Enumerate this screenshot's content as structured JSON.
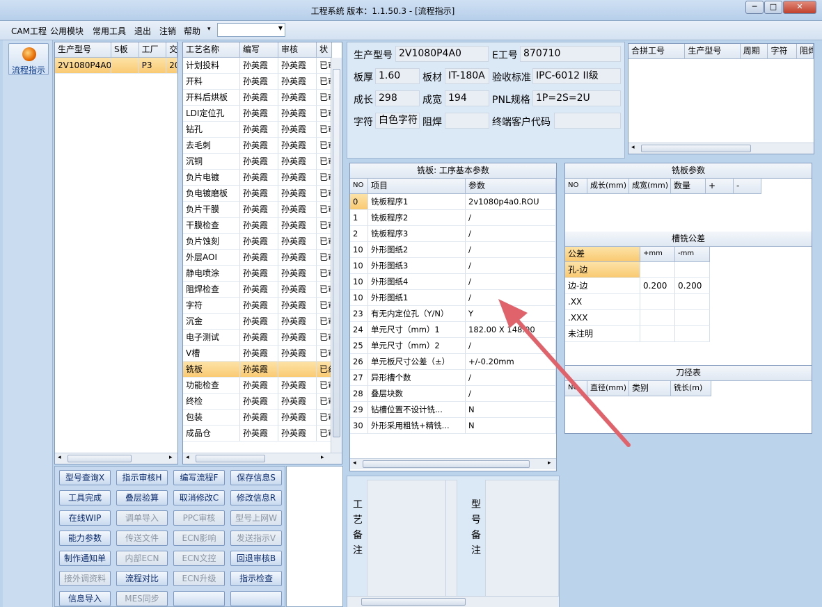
{
  "window": {
    "title": "工程系统   版本：1.1.50.3 - [流程指示]",
    "min": "─",
    "max": "□",
    "close": "✕"
  },
  "menu": {
    "items": [
      "CAM工程",
      "公用模块",
      "常用工具",
      "退出",
      "注销",
      "帮助"
    ],
    "combo_value": "",
    "mdi": [
      "_",
      "🗗",
      "×"
    ]
  },
  "sidebar": {
    "button_label": "流程指示",
    "icon": "flame-icon"
  },
  "model_grid": {
    "headers": [
      "生产型号",
      "S板",
      "工厂",
      "交"
    ],
    "rows": [
      [
        "2V1080P4A0",
        "",
        "P3",
        "20"
      ]
    ]
  },
  "process_grid": {
    "headers": [
      "工艺名称",
      "编写",
      "审核",
      "状"
    ],
    "rows": [
      [
        "计划投料",
        "孙英霞",
        "孙英霞",
        "已审"
      ],
      [
        "开料",
        "孙英霞",
        "孙英霞",
        "已审"
      ],
      [
        "开料后烘板",
        "孙英霞",
        "孙英霞",
        "已审"
      ],
      [
        "LDI定位孔",
        "孙英霞",
        "孙英霞",
        "已审"
      ],
      [
        "钻孔",
        "孙英霞",
        "孙英霞",
        "已审"
      ],
      [
        "去毛刺",
        "孙英霞",
        "孙英霞",
        "已审"
      ],
      [
        "沉铜",
        "孙英霞",
        "孙英霞",
        "已审"
      ],
      [
        "负片电镀",
        "孙英霞",
        "孙英霞",
        "已审"
      ],
      [
        "负电镀磨板",
        "孙英霞",
        "孙英霞",
        "已审"
      ],
      [
        "负片干膜",
        "孙英霞",
        "孙英霞",
        "已审"
      ],
      [
        "干膜检查",
        "孙英霞",
        "孙英霞",
        "已审"
      ],
      [
        "负片蚀刻",
        "孙英霞",
        "孙英霞",
        "已审"
      ],
      [
        "外层AOI",
        "孙英霞",
        "孙英霞",
        "已审"
      ],
      [
        "静电喷涂",
        "孙英霞",
        "孙英霞",
        "已审"
      ],
      [
        "阻焊检查",
        "孙英霞",
        "孙英霞",
        "已审"
      ],
      [
        "字符",
        "孙英霞",
        "孙英霞",
        "已审"
      ],
      [
        "沉金",
        "孙英霞",
        "孙英霞",
        "已审"
      ],
      [
        "电子测试",
        "孙英霞",
        "孙英霞",
        "已审"
      ],
      [
        "V槽",
        "孙英霞",
        "孙英霞",
        "已审"
      ],
      [
        "铣板",
        "孙英霞",
        "",
        "已纟"
      ],
      [
        "功能检查",
        "孙英霞",
        "孙英霞",
        "已审"
      ],
      [
        "终检",
        "孙英霞",
        "孙英霞",
        "已审"
      ],
      [
        "包装",
        "孙英霞",
        "孙英霞",
        "已审"
      ],
      [
        "成品仓",
        "孙英霞",
        "孙英霞",
        "已审"
      ]
    ],
    "selected_index": 19
  },
  "buttons": [
    {
      "label": "型号查询X",
      "enabled": true
    },
    {
      "label": "指示审核H",
      "enabled": true
    },
    {
      "label": "编写流程F",
      "enabled": true
    },
    {
      "label": "保存信息S",
      "enabled": true
    },
    {
      "label": "工具完成",
      "enabled": true
    },
    {
      "label": "叠层验算",
      "enabled": true
    },
    {
      "label": "取消修改C",
      "enabled": true
    },
    {
      "label": "修改信息R",
      "enabled": true
    },
    {
      "label": "在线WIP",
      "enabled": true
    },
    {
      "label": "调单导入",
      "enabled": false
    },
    {
      "label": "PPC审核",
      "enabled": false
    },
    {
      "label": "型号上网W",
      "enabled": false
    },
    {
      "label": "能力参数",
      "enabled": true
    },
    {
      "label": "传送文件",
      "enabled": false
    },
    {
      "label": "ECN影响",
      "enabled": false
    },
    {
      "label": "发送指示V",
      "enabled": false
    },
    {
      "label": "制作通知单",
      "enabled": true
    },
    {
      "label": "内部ECN",
      "enabled": false
    },
    {
      "label": "ECN文控",
      "enabled": false
    },
    {
      "label": "回退审核B",
      "enabled": true
    },
    {
      "label": "接外调资料",
      "enabled": false
    },
    {
      "label": "流程对比",
      "enabled": true
    },
    {
      "label": "ECN升级",
      "enabled": false
    },
    {
      "label": "指示检查",
      "enabled": true
    },
    {
      "label": "信息导入",
      "enabled": true
    },
    {
      "label": "MES同步",
      "enabled": false
    },
    {
      "label": "",
      "enabled": true
    },
    {
      "label": "",
      "enabled": true
    }
  ],
  "form": {
    "product_model_label": "生产型号",
    "product_model": "2V1080P4A0",
    "e_no_label": "E工号",
    "e_no": "870710",
    "thickness_label": "板厚",
    "thickness": "1.60",
    "material_label": "板材",
    "material": "IT-180A",
    "standard_label": "验收标准",
    "standard": "IPC-6012 II级",
    "length_label": "成长",
    "length": "298",
    "width_label": "成宽",
    "width": "194",
    "pnl_label": "PNL规格",
    "pnl": "1P=2S=2U",
    "char_label": "字符",
    "char": "白色字符",
    "mask_label": "阻焊",
    "mask": "",
    "customer_label": "终端客户代码",
    "customer": ""
  },
  "merge_grid": {
    "headers": [
      "合拼工号",
      "生产型号",
      "周期",
      "字符",
      "阻焊"
    ]
  },
  "mill_basic": {
    "title": "铣板: 工序基本参数",
    "headers": [
      "NO",
      "项目",
      "参数"
    ],
    "rows": [
      [
        "0",
        "铣板程序1",
        "2v1080p4a0.ROU"
      ],
      [
        "1",
        "铣板程序2",
        "/"
      ],
      [
        "2",
        "铣板程序3",
        "/"
      ],
      [
        "10",
        "外形图纸2",
        "/"
      ],
      [
        "10",
        "外形图纸3",
        "/"
      ],
      [
        "10",
        "外形图纸4",
        "/"
      ],
      [
        "10",
        "外形图纸1",
        "/"
      ],
      [
        "23",
        "有无内定位孔（Y/N）",
        "Y"
      ],
      [
        "24",
        "单元尺寸（mm）1",
        "182.00 X 148.00"
      ],
      [
        "25",
        "单元尺寸（mm）2",
        "/"
      ],
      [
        "26",
        "单元板尺寸公差（±）",
        "+/-0.20mm"
      ],
      [
        "27",
        "异形槽个数",
        "/"
      ],
      [
        "28",
        "叠层块数",
        "/"
      ],
      [
        "29",
        "钻槽位置不设计铣...",
        "N"
      ],
      [
        "30",
        "外形采用粗铣+精铣...",
        "N"
      ]
    ],
    "selected_index": 0
  },
  "mill_params": {
    "title": "铣板参数",
    "headers": [
      "NO",
      "成长(mm)",
      "成宽(mm)",
      "数量",
      "+",
      "-"
    ]
  },
  "slot_tol": {
    "title": "槽铣公差",
    "headers": [
      "公差",
      "+mm",
      "-mm"
    ],
    "rows": [
      [
        "孔-边",
        "",
        ""
      ],
      [
        "边-边",
        "0.200",
        "0.200"
      ],
      [
        ".XX",
        "",
        ""
      ],
      [
        ".XXX",
        "",
        ""
      ],
      [
        "未注明",
        "",
        ""
      ]
    ],
    "selected_index": 0
  },
  "tool_table": {
    "title": "刀径表",
    "headers": [
      "NO",
      "直径(mm)",
      "类别",
      "铣长(m)"
    ]
  },
  "notes": {
    "process_label": "工艺备注",
    "model_label": "型号备注"
  }
}
